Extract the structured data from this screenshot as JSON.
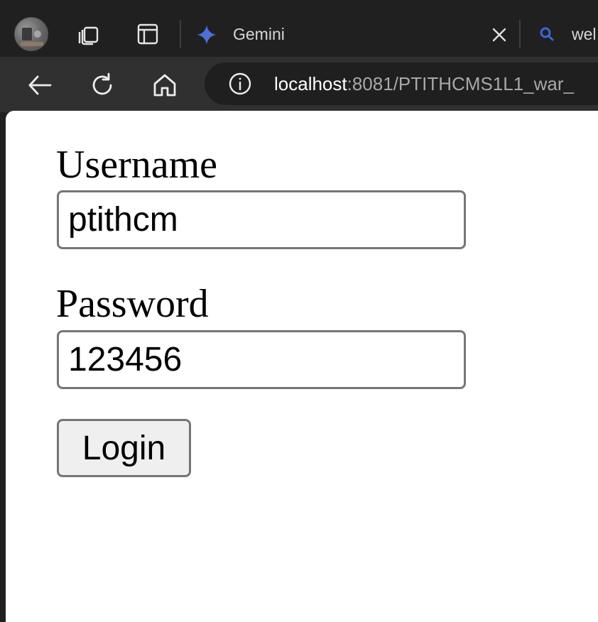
{
  "browser": {
    "tabs": [
      {
        "title": "Gemini",
        "icon": "gemini-star-icon"
      },
      {
        "title": "wel",
        "icon": "search-icon"
      }
    ],
    "address_bar": {
      "host": "localhost",
      "path": ":8081/PTITHCMS1L1_war_"
    }
  },
  "login_form": {
    "username_label": "Username",
    "username_value": "ptithcm",
    "password_label": "Password",
    "password_value": "123456",
    "login_button": "Login"
  },
  "colors": {
    "tabbar_bg": "#202020",
    "toolbar_bg": "#303030",
    "address_bg": "#1f1f1f",
    "gemini_accent": "#4d6fd6",
    "search_accent": "#3e64d6",
    "page_bg": "#ffffff",
    "input_border": "#767676",
    "button_bg": "#efefef"
  }
}
